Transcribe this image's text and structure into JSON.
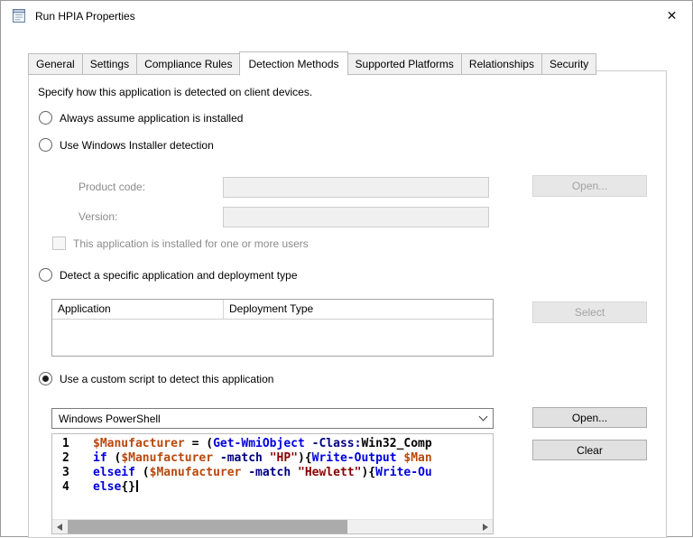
{
  "window": {
    "title": "Run HPIA Properties",
    "close_glyph": "✕"
  },
  "tabs": [
    {
      "label": "General"
    },
    {
      "label": "Settings"
    },
    {
      "label": "Compliance Rules"
    },
    {
      "label": "Detection Methods"
    },
    {
      "label": "Supported Platforms"
    },
    {
      "label": "Relationships"
    },
    {
      "label": "Security"
    }
  ],
  "active_tab": "Detection Methods",
  "content": {
    "instruction": "Specify how this application is detected on client devices.",
    "radios": {
      "always": {
        "label": "Always assume application is installed",
        "selected": false
      },
      "msi": {
        "label": "Use Windows Installer detection",
        "selected": false
      },
      "specific": {
        "label": "Detect a specific application and deployment type",
        "selected": false
      },
      "script": {
        "label": "Use a custom script to detect this application",
        "selected": true
      }
    },
    "msi_section": {
      "product_code_label": "Product code:",
      "product_code_value": "",
      "version_label": "Version:",
      "version_value": "",
      "open_button": "Open...",
      "open_enabled": false,
      "checkbox_label": "This application is installed for one or more users",
      "checkbox_checked": false
    },
    "specific_section": {
      "columns": [
        "Application",
        "Deployment Type"
      ],
      "rows": [],
      "select_button": "Select",
      "select_enabled": false
    },
    "script_section": {
      "language_selected": "Windows PowerShell",
      "open_button": "Open...",
      "clear_button": "Clear",
      "token_colors": {
        "plain": "#000000",
        "variable": "#b9480b",
        "cmdlet": "#0000e0",
        "parameter": "#000080",
        "string": "#8b0000",
        "keyword": "#0000e0"
      },
      "lines": [
        {
          "num": "1",
          "tokens": [
            {
              "c": "variable",
              "t": "$Manufacturer"
            },
            {
              "c": "plain",
              "t": " = ("
            },
            {
              "c": "cmdlet",
              "t": "Get-WmiObject"
            },
            {
              "c": "plain",
              "t": " "
            },
            {
              "c": "parameter",
              "t": "-Class:"
            },
            {
              "c": "plain",
              "t": "Win32_Comp"
            }
          ]
        },
        {
          "num": "2",
          "tokens": [
            {
              "c": "keyword",
              "t": "if"
            },
            {
              "c": "plain",
              "t": " ("
            },
            {
              "c": "variable",
              "t": "$Manufacturer"
            },
            {
              "c": "plain",
              "t": " "
            },
            {
              "c": "parameter",
              "t": "-match"
            },
            {
              "c": "plain",
              "t": " "
            },
            {
              "c": "string",
              "t": "\"HP\""
            },
            {
              "c": "plain",
              "t": "){"
            },
            {
              "c": "cmdlet",
              "t": "Write-Output"
            },
            {
              "c": "plain",
              "t": " "
            },
            {
              "c": "variable",
              "t": "$Man"
            }
          ]
        },
        {
          "num": "3",
          "tokens": [
            {
              "c": "keyword",
              "t": "elseif"
            },
            {
              "c": "plain",
              "t": " ("
            },
            {
              "c": "variable",
              "t": "$Manufacturer"
            },
            {
              "c": "plain",
              "t": " "
            },
            {
              "c": "parameter",
              "t": "-match"
            },
            {
              "c": "plain",
              "t": " "
            },
            {
              "c": "string",
              "t": "\"Hewlett\""
            },
            {
              "c": "plain",
              "t": "){"
            },
            {
              "c": "cmdlet",
              "t": "Write-Ou"
            }
          ]
        },
        {
          "num": "4",
          "tokens": [
            {
              "c": "keyword",
              "t": "else"
            },
            {
              "c": "plain",
              "t": "{}"
            },
            {
              "c": "cursor",
              "t": ""
            }
          ]
        }
      ]
    }
  }
}
